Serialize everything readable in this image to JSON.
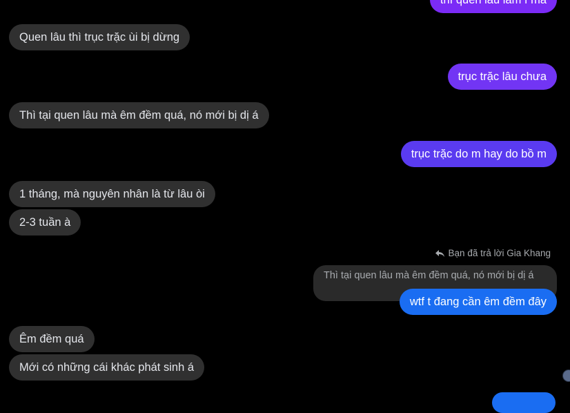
{
  "colors": {
    "incoming_bubble": "#303030",
    "outgoing_purple": "#7a2cf5",
    "outgoing_indigo": "#5b3af0",
    "outgoing_blue": "#1670f0",
    "quoted_bubble": "#2a2a2a"
  },
  "messages": {
    "m0_partial": "thì quen lâu lắm í mà",
    "m1": "Quen lâu thì trục trặc ùi bị dừng",
    "m2": "trục trặc lâu chưa",
    "m3": "Thì tại quen lâu mà êm đềm quá, nó mới bị dị á",
    "m4": "trục trặc do m hay do bồ m",
    "m5": "1 tháng, mà nguyên nhân là từ lâu òi",
    "m6": "2-3 tuần à",
    "m8": "wtf t đang cần êm đềm đây",
    "m9": "Êm đềm quá",
    "m10": "Mới có những cái khác phát sinh á"
  },
  "reply": {
    "icon": "reply-arrow-icon",
    "label": "Bạn đã trả lời Gia Khang",
    "quoted_text": "Thì tại quen lâu mà êm đềm quá, nó mới bị dị á"
  }
}
